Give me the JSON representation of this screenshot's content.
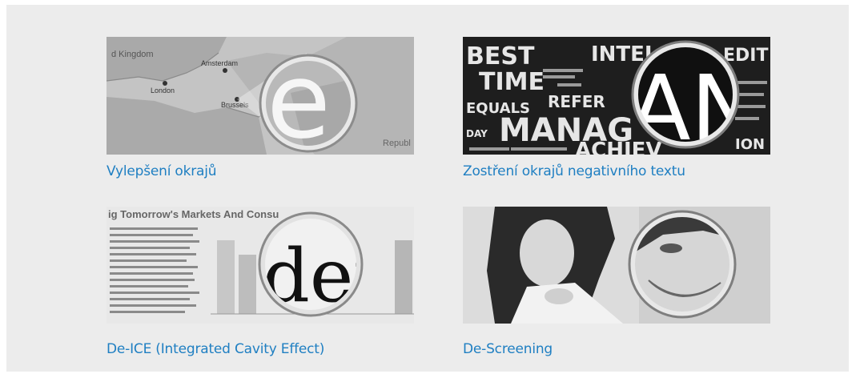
{
  "cards": [
    {
      "caption": "Vylepšení okrajů",
      "map_labels": [
        "d Kingdom",
        "Amsterdam",
        "London",
        "Brussels",
        "Republ"
      ],
      "magnified": "e"
    },
    {
      "caption": "Zostření okrajů negativního textu",
      "magnified": "AN",
      "wordcloud": [
        "BEST",
        "INTEL",
        "EDIT",
        "TIME",
        "EQUALS",
        "REFER",
        "MANAG",
        "ACHIEV",
        "ION",
        "DAY"
      ]
    },
    {
      "caption": "De-ICE (Integrated Cavity Effect)",
      "magnified": "dei",
      "headline": "ig Tomorrow's Markets And Consu"
    },
    {
      "caption": "De-Screening"
    }
  ],
  "colors": {
    "caption": "#1f7fc2",
    "background": "#ececec"
  }
}
